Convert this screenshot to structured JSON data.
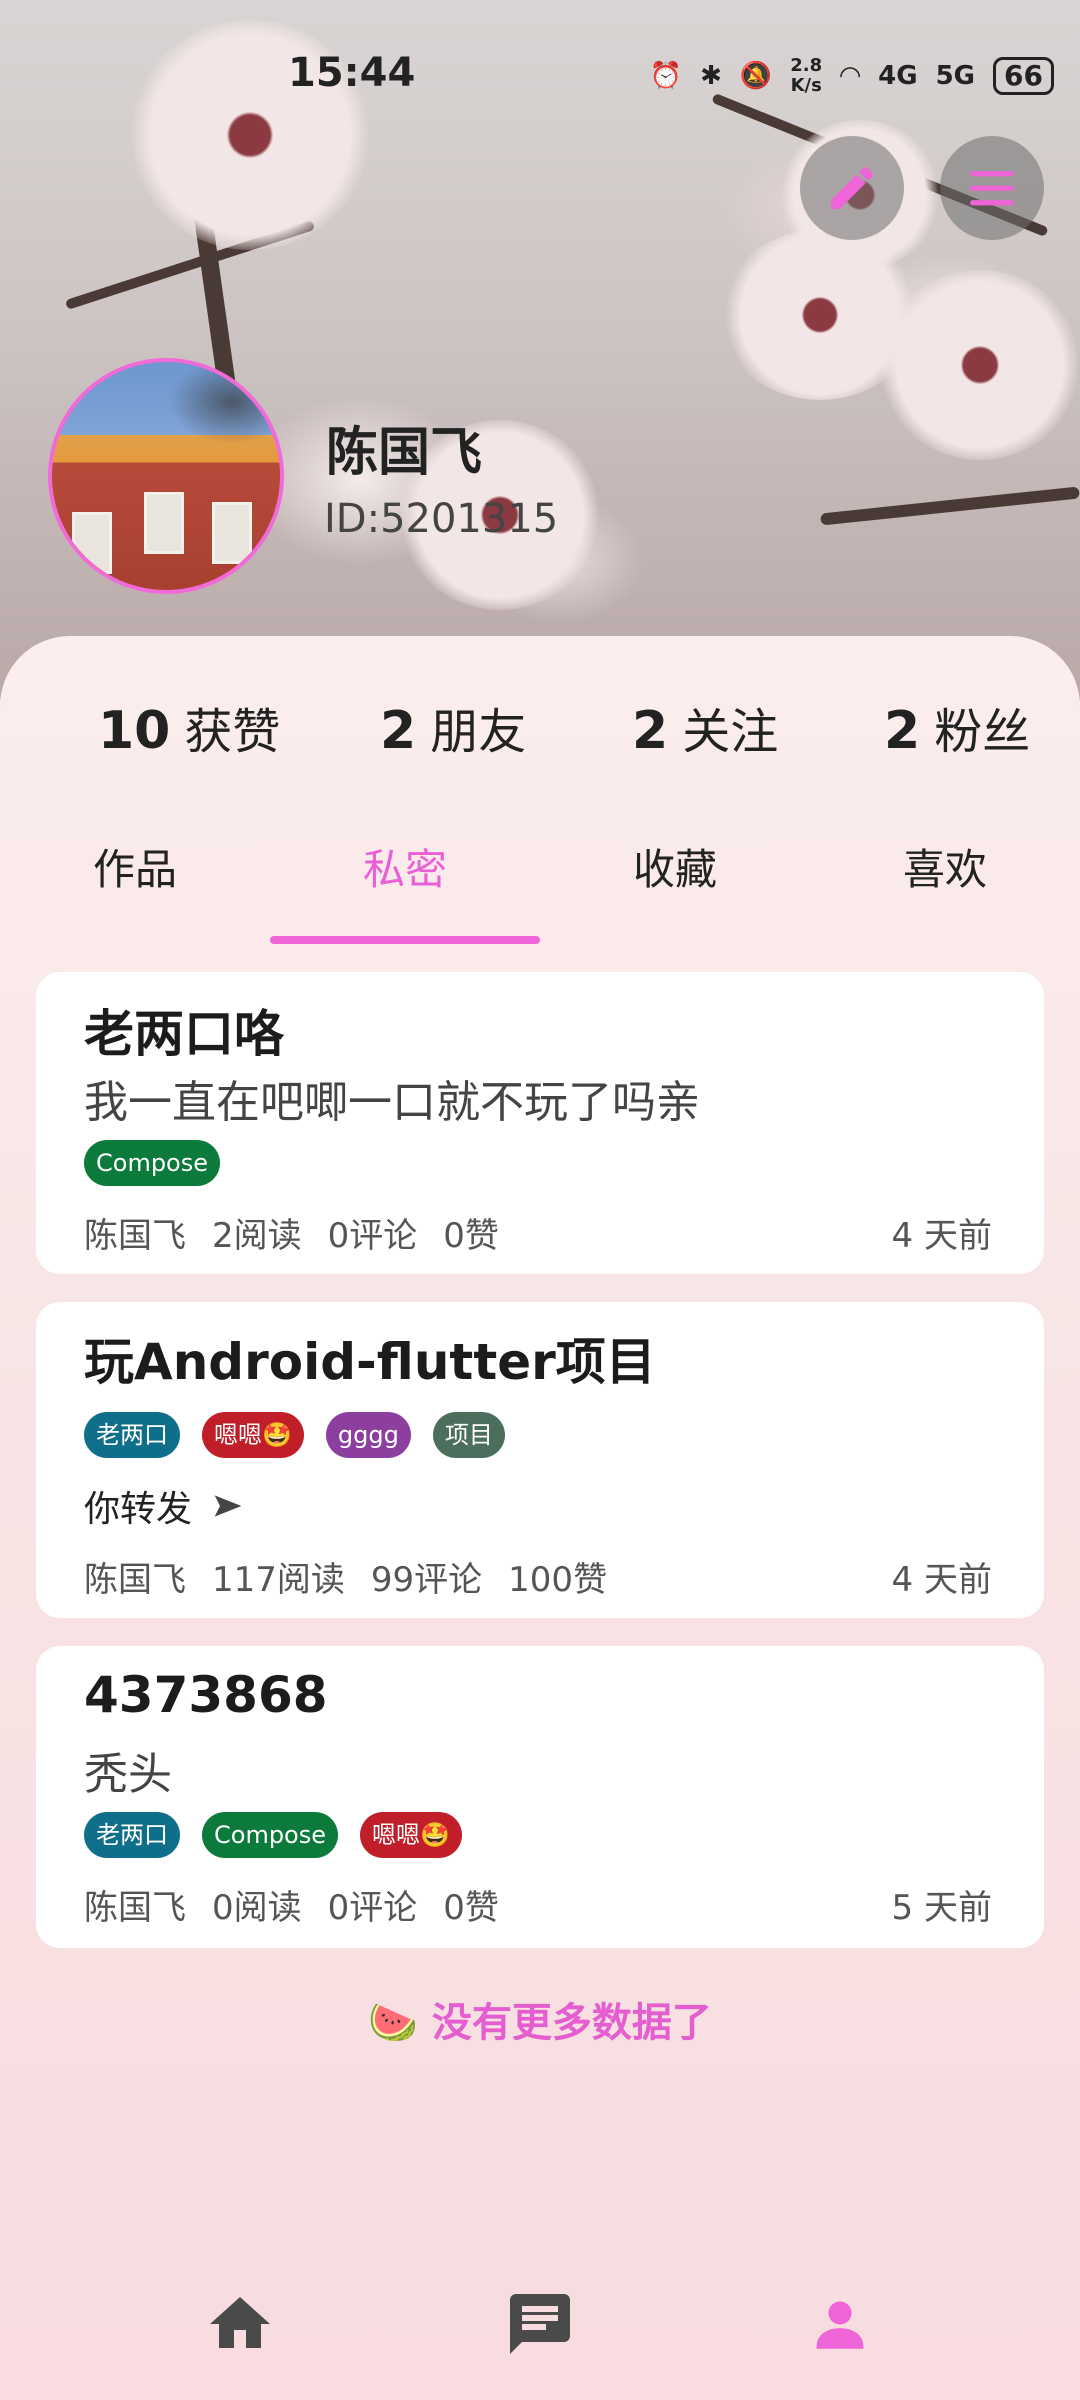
{
  "status_bar": {
    "time": "15:44",
    "net_speed": "2.8\nK/s",
    "battery": "66",
    "network_4g": "4G",
    "network_5g": "5G"
  },
  "header": {
    "edit_icon": "pencil-icon",
    "menu_icon": "hamburger-menu-icon"
  },
  "profile": {
    "name": "陈国飞",
    "id": "ID:5201315"
  },
  "stats": [
    {
      "num": "10",
      "label": "获赞"
    },
    {
      "num": "2",
      "label": "朋友"
    },
    {
      "num": "2",
      "label": "关注"
    },
    {
      "num": "2",
      "label": "粉丝"
    }
  ],
  "tabs": [
    {
      "label": "作品"
    },
    {
      "label": "私密",
      "active": true
    },
    {
      "label": "收藏"
    },
    {
      "label": "喜欢"
    }
  ],
  "posts": [
    {
      "title": "老两口咯",
      "desc": "我一直在吧唧一口就不玩了吗亲",
      "tags": [
        "Compose"
      ],
      "author": "陈国飞",
      "reads": "2阅读",
      "comments": "0评论",
      "likes": "0赞",
      "time": "4 天前"
    },
    {
      "title": "玩Android-flutter项目",
      "tags": [
        "老两口",
        "嗯嗯🤩",
        "gggg",
        "项目"
      ],
      "share": "你转发",
      "author": "陈国飞",
      "reads": "117阅读",
      "comments": "99评论",
      "likes": "100赞",
      "time": "4 天前"
    },
    {
      "title": "4373868",
      "desc": "秃头",
      "tags": [
        "老两口",
        "Compose",
        "嗯嗯🤩"
      ],
      "author": "陈国飞",
      "reads": "0阅读",
      "comments": "0评论",
      "likes": "0赞",
      "time": "5 天前"
    }
  ],
  "footer_text": "🍉 没有更多数据了",
  "bottom_nav": {
    "home_icon": "home-icon",
    "message_icon": "message-icon",
    "profile_icon": "person-icon"
  },
  "colors": {
    "accent": "#ef64d7",
    "tag_teal": "#0f6f8a",
    "tag_green": "#0c7a3a",
    "tag_red": "#c01f2a",
    "tag_purple": "#8d3fa0",
    "tag_gray": "#4c6e5c"
  }
}
